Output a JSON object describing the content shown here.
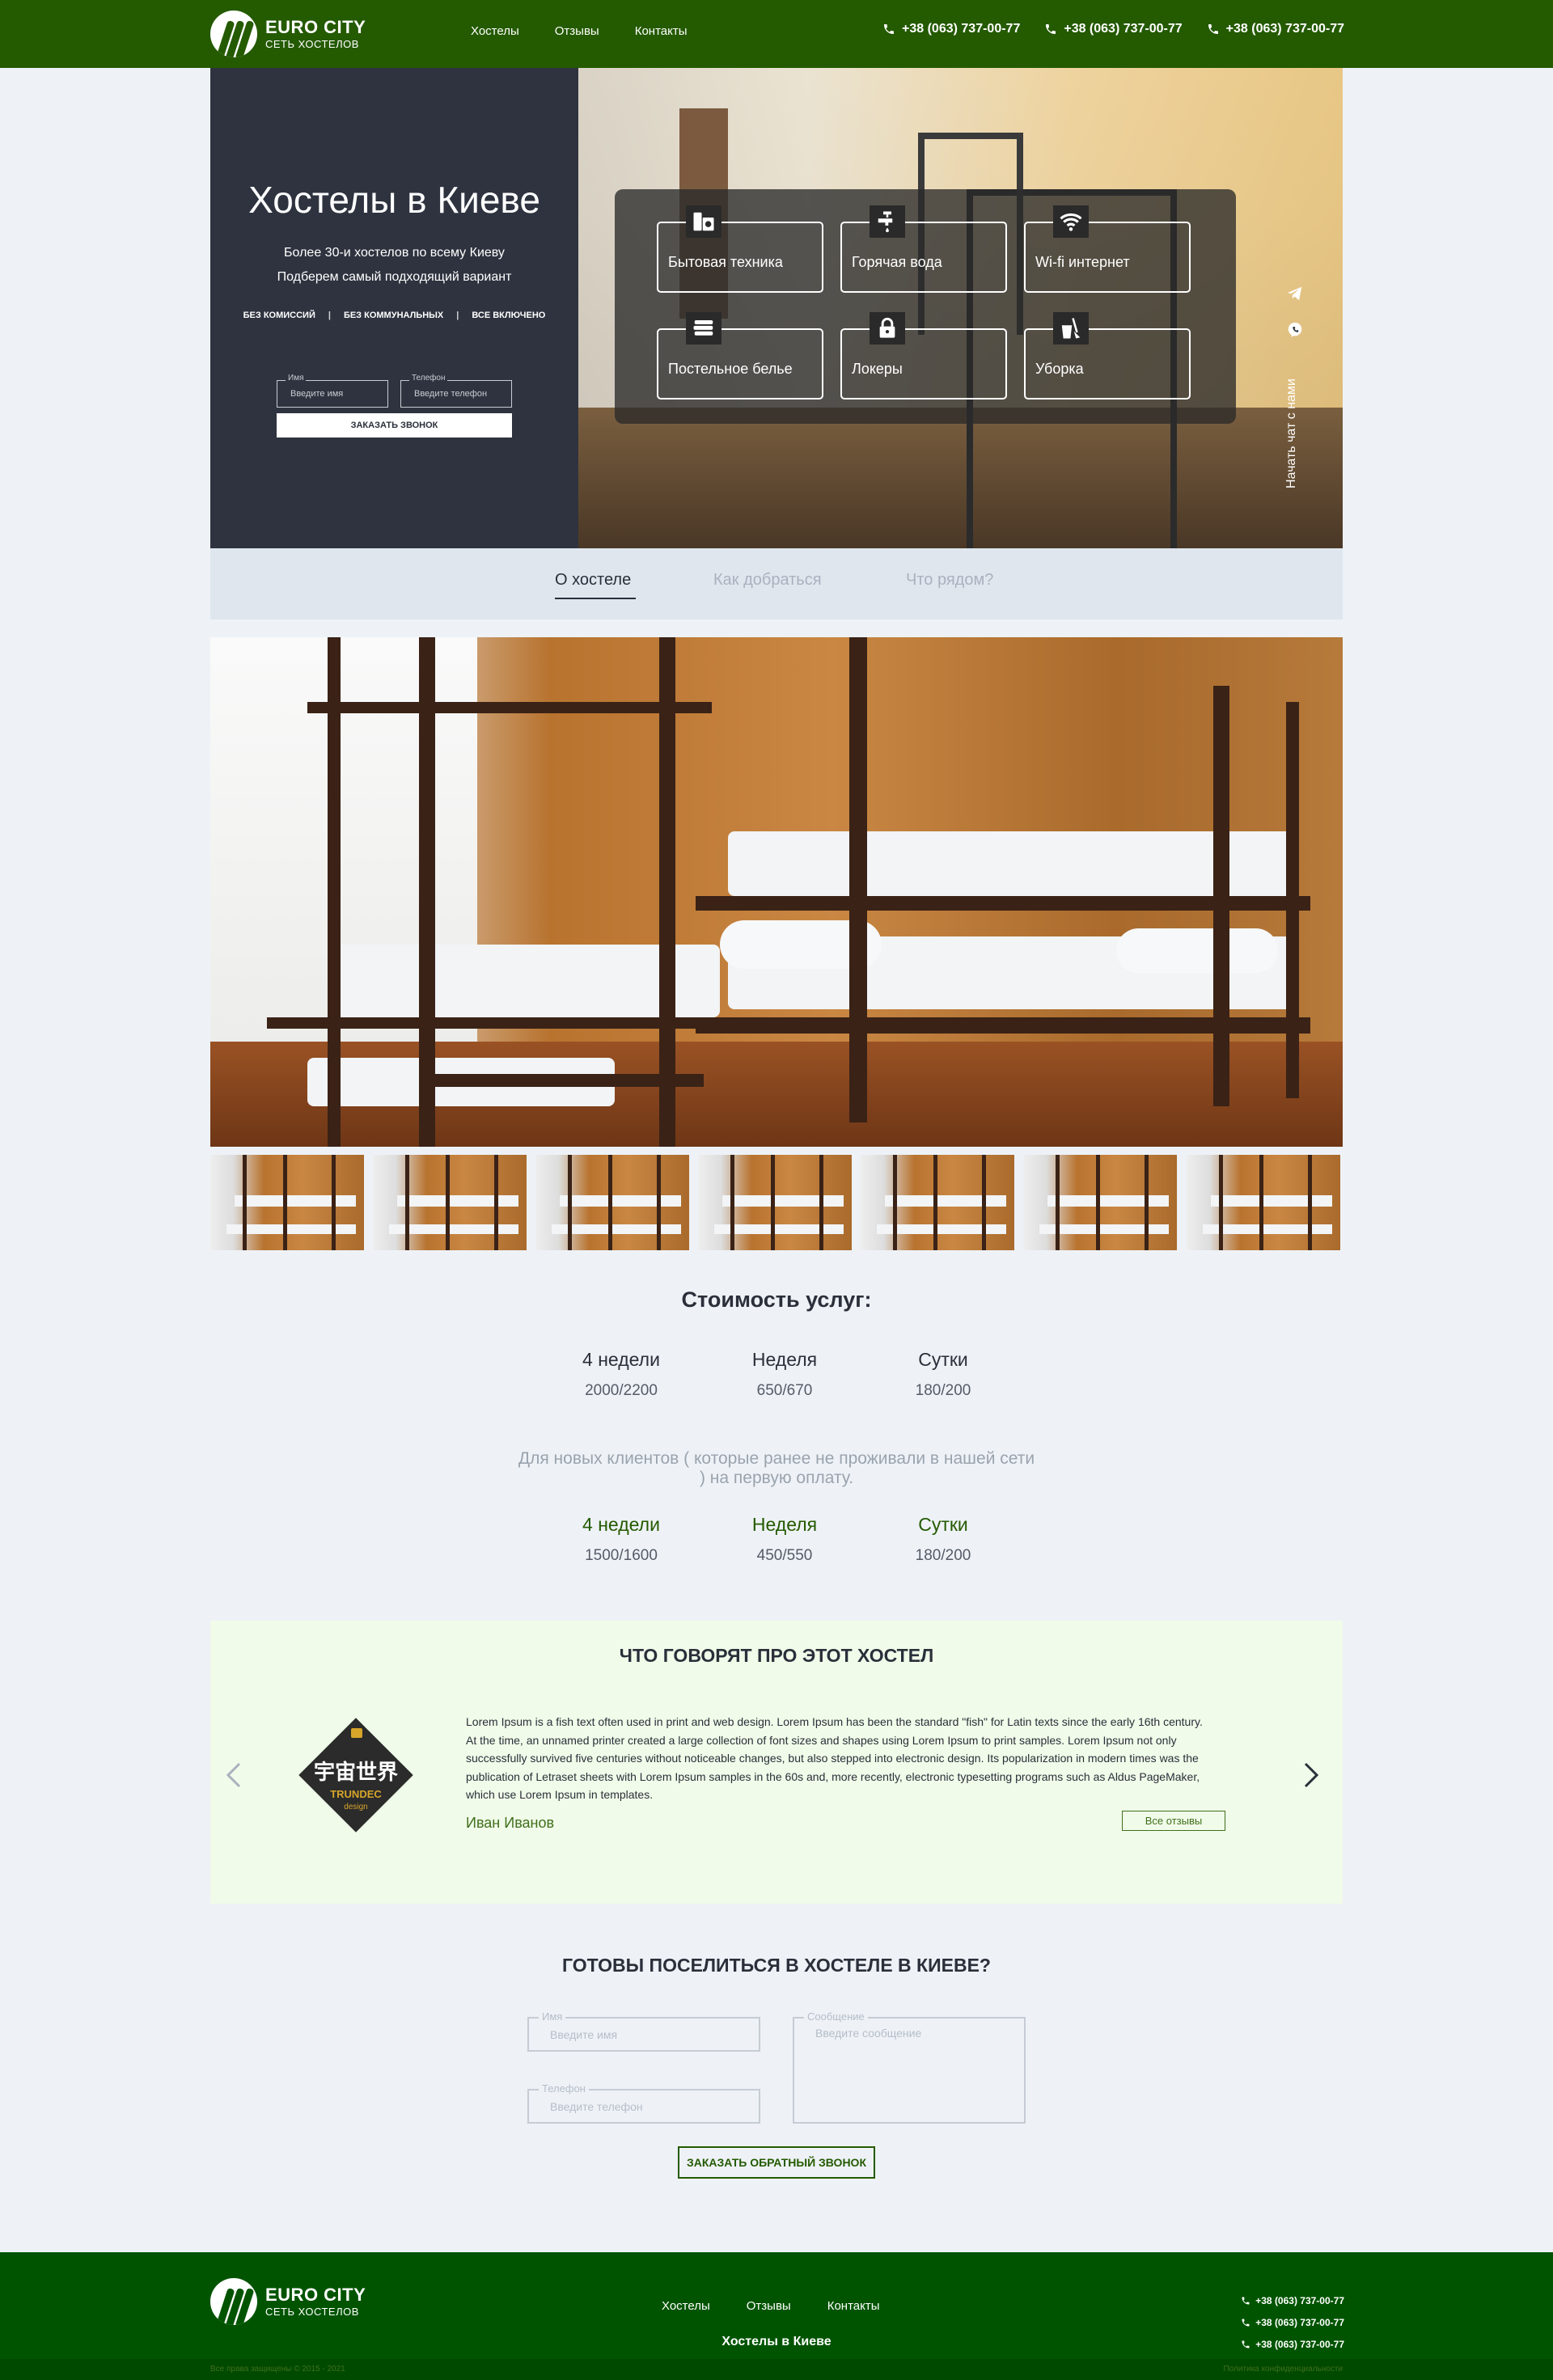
{
  "brand": {
    "name": "EURO CITY",
    "tagline": "СЕТЬ ХОСТЕЛОВ"
  },
  "nav": [
    "Хостелы",
    "Отзывы",
    "Контакты"
  ],
  "phones": [
    "+38 (063) 737-00-77",
    "+38 (063) 737-00-77",
    "+38 (063) 737-00-77"
  ],
  "hero": {
    "title": "Хостелы в Киеве",
    "sub1": "Более 30-и хостелов по всему Киеву",
    "sub2": "Подберем самый подходящий вариант",
    "tags": [
      "БЕЗ КОМИССИЙ",
      "БЕЗ КОММУНАЛЬНЫХ",
      "ВСЕ ВКЛЮЧЕНО"
    ],
    "name_label": "Имя",
    "name_placeholder": "Введите имя",
    "phone_label": "Телефон",
    "phone_placeholder": "Введите телефон",
    "button": "ЗАКАЗАТЬ ЗВОНОК"
  },
  "features": [
    {
      "label": "Бытовая техника",
      "icon": "appliances-icon"
    },
    {
      "label": "Горячая вода",
      "icon": "faucet-icon"
    },
    {
      "label": "Wi-fi интернет",
      "icon": "wifi-icon"
    },
    {
      "label": "Постельное белье",
      "icon": "bed-linen-icon"
    },
    {
      "label": "Локеры",
      "icon": "lock-icon"
    },
    {
      "label": "Уборка",
      "icon": "cleaning-icon"
    }
  ],
  "chat": {
    "label": "Начать чат с нами"
  },
  "tabs": [
    {
      "label": "О хостеле",
      "active": true
    },
    {
      "label": "Как добраться",
      "active": false
    },
    {
      "label": "Что рядом?",
      "active": false
    }
  ],
  "prices": {
    "title": "Стоимость услуг:",
    "regular": [
      {
        "period": "4 недели",
        "price": "2000/2200"
      },
      {
        "period": "Неделя",
        "price": "650/670"
      },
      {
        "period": "Сутки",
        "price": "180/200"
      }
    ],
    "note": "Для новых клиентов ( которые ранее не проживали в нашей сети ) на первую оплату.",
    "new_clients": [
      {
        "period": "4 недели",
        "price": "1500/1600"
      },
      {
        "period": "Неделя",
        "price": "450/550"
      },
      {
        "period": "Сутки",
        "price": "180/200"
      }
    ]
  },
  "reviews": {
    "title": "ЧТО ГОВОРЯТ ПРО ЭТОТ ХОСТЕЛ",
    "logo_text": "宇宙世界",
    "logo_sub": "TRUNDEC",
    "logo_sub2": "design",
    "text": "Lorem Ipsum is a fish text often used in print and web design. Lorem Ipsum has been the standard \"fish\" for Latin texts since the early 16th century. At the time, an unnamed printer created a large collection of font sizes and shapes using Lorem Ipsum to print samples. Lorem Ipsum not only successfully survived five centuries without noticeable changes, but also stepped into electronic design. Its popularization in modern times was the publication of Letraset sheets with Lorem Ipsum samples in the 60s and, more recently, electronic typesetting programs such as Aldus PageMaker, which use Lorem Ipsum in templates.",
    "author": "Иван Иванов",
    "all_button": "Все отзывы"
  },
  "contact": {
    "title": "ГОТОВЫ ПОСЕЛИТЬСЯ В ХОСТЕЛЕ В КИЕВЕ?",
    "name_label": "Имя",
    "name_placeholder": "Введите имя",
    "phone_label": "Телефон",
    "phone_placeholder": "Введите телефон",
    "message_label": "Сообщение",
    "message_placeholder": "Введите сообщение",
    "button": "ЗАКАЗАТЬ ОБРАТНЫЙ ЗВОНОК"
  },
  "footer": {
    "nav": [
      "Хостелы",
      "Отзывы",
      "Контакты"
    ],
    "title": "Хостелы в Киеве",
    "phones": [
      "+38 (063) 737-00-77",
      "+38 (063) 737-00-77",
      "+38 (063) 737-00-77"
    ],
    "copyright": "Все права защищены © 2015 - 2021",
    "privacy": "Политика конфиденциальности"
  },
  "colors": {
    "header_bg": "#245a00",
    "hero_left_bg": "#2e333f",
    "accent_green": "#245a00",
    "review_bg": "#f1fbe9",
    "footer_bg": "#005400"
  }
}
